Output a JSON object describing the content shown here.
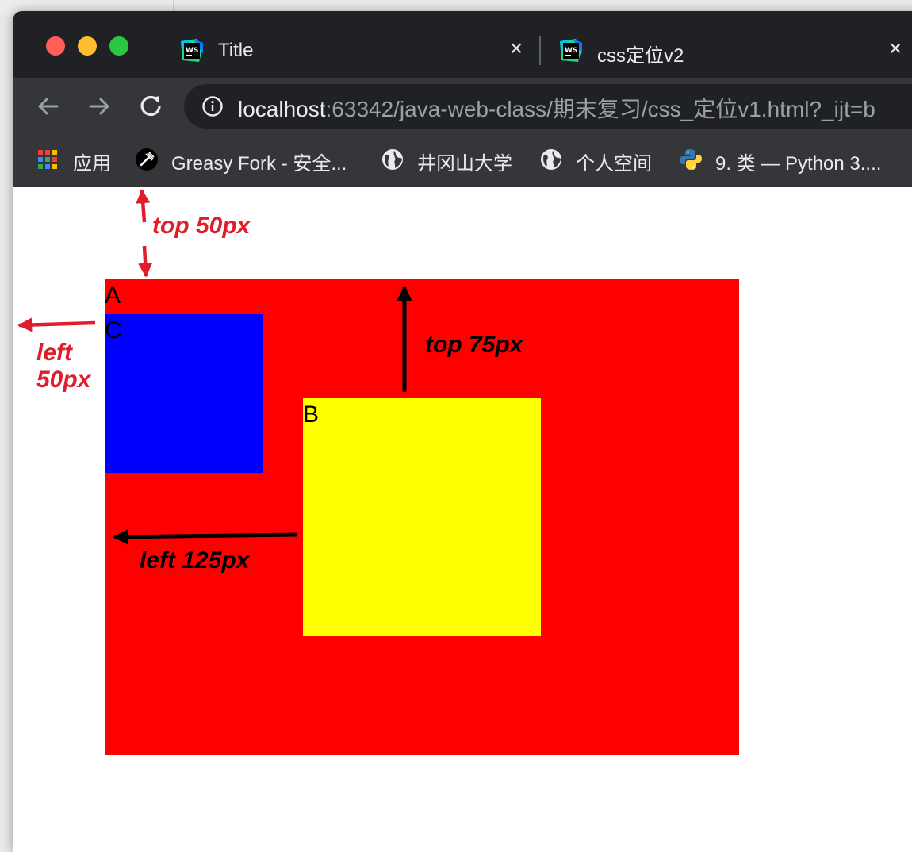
{
  "browser": {
    "tabs": [
      {
        "title": "Title",
        "active": true
      },
      {
        "title": "css定位v2",
        "active": false
      }
    ],
    "url": {
      "host": "localhost",
      "rest": ":63342/java-web-class/期末复习/css_定位v1.html?_ijt=b"
    },
    "bookmarks": [
      {
        "label": "应用",
        "icon": "apps-grid-icon"
      },
      {
        "label": "Greasy Fork - 安全...",
        "icon": "greasy-fork-icon"
      },
      {
        "label": "井冈山大学",
        "icon": "globe-icon"
      },
      {
        "label": "个人空间",
        "icon": "globe-icon"
      },
      {
        "label": "9. 类 — Python 3....",
        "icon": "python-icon"
      }
    ]
  },
  "page": {
    "boxes": [
      {
        "label": "A",
        "color": "#ff0000"
      },
      {
        "label": "C",
        "color": "#0000ff"
      },
      {
        "label": "B",
        "color": "#ffff00"
      }
    ],
    "annotations": [
      {
        "text": "top 50px",
        "color": "#e01e2b"
      },
      {
        "text": "left 50px",
        "color": "#e01e2b"
      },
      {
        "text": "top 75px",
        "color": "#000000"
      },
      {
        "text": "left 125px",
        "color": "#000000"
      }
    ]
  }
}
